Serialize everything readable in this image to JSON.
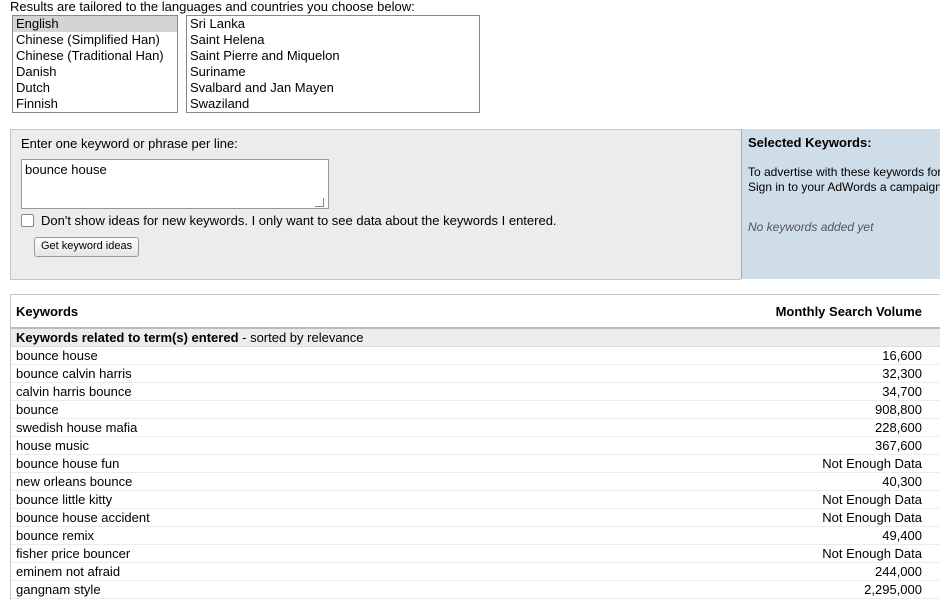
{
  "intro_text": "Results are tailored to the languages and countries you choose below:",
  "languages": [
    {
      "label": "English",
      "selected": true
    },
    {
      "label": "Chinese (Simplified Han)",
      "selected": false
    },
    {
      "label": "Chinese (Traditional Han)",
      "selected": false
    },
    {
      "label": "Danish",
      "selected": false
    },
    {
      "label": "Dutch",
      "selected": false
    },
    {
      "label": "Finnish",
      "selected": false
    }
  ],
  "countries": [
    {
      "label": "Sri Lanka"
    },
    {
      "label": "Saint Helena"
    },
    {
      "label": "Saint Pierre and Miquelon"
    },
    {
      "label": "Suriname"
    },
    {
      "label": "Svalbard and Jan Mayen"
    },
    {
      "label": "Swaziland"
    }
  ],
  "keyword_entry": {
    "label": "Enter one keyword or phrase per line:",
    "value": "bounce house",
    "checkbox_label": "Don't show ideas for new keywords. I only want to see data about the keywords I entered.",
    "checkbox_checked": false,
    "button_label": "Get keyword ideas"
  },
  "selected_keywords": {
    "title": "Selected Keywords:",
    "description": "To advertise with these keywords format. Sign in to your AdWords a campaign.",
    "empty_text": "No keywords added yet"
  },
  "results": {
    "col_keywords": "Keywords",
    "col_volume": "Monthly Search Volume",
    "group_bold": "Keywords related to term(s) entered",
    "group_rest": " - sorted by relevance",
    "rows": [
      {
        "keyword": "bounce house",
        "volume": "16,600"
      },
      {
        "keyword": "bounce calvin harris",
        "volume": "32,300"
      },
      {
        "keyword": "calvin harris bounce",
        "volume": "34,700"
      },
      {
        "keyword": "bounce",
        "volume": "908,800"
      },
      {
        "keyword": "swedish house mafia",
        "volume": "228,600"
      },
      {
        "keyword": "house music",
        "volume": "367,600"
      },
      {
        "keyword": "bounce house fun",
        "volume": "Not Enough Data"
      },
      {
        "keyword": "new orleans bounce",
        "volume": "40,300"
      },
      {
        "keyword": "bounce little kitty",
        "volume": "Not Enough Data"
      },
      {
        "keyword": "bounce house accident",
        "volume": "Not Enough Data"
      },
      {
        "keyword": "bounce remix",
        "volume": "49,400"
      },
      {
        "keyword": "fisher price bouncer",
        "volume": "Not Enough Data"
      },
      {
        "keyword": "eminem not afraid",
        "volume": "244,000"
      },
      {
        "keyword": "gangnam style",
        "volume": "2,295,000"
      }
    ]
  }
}
